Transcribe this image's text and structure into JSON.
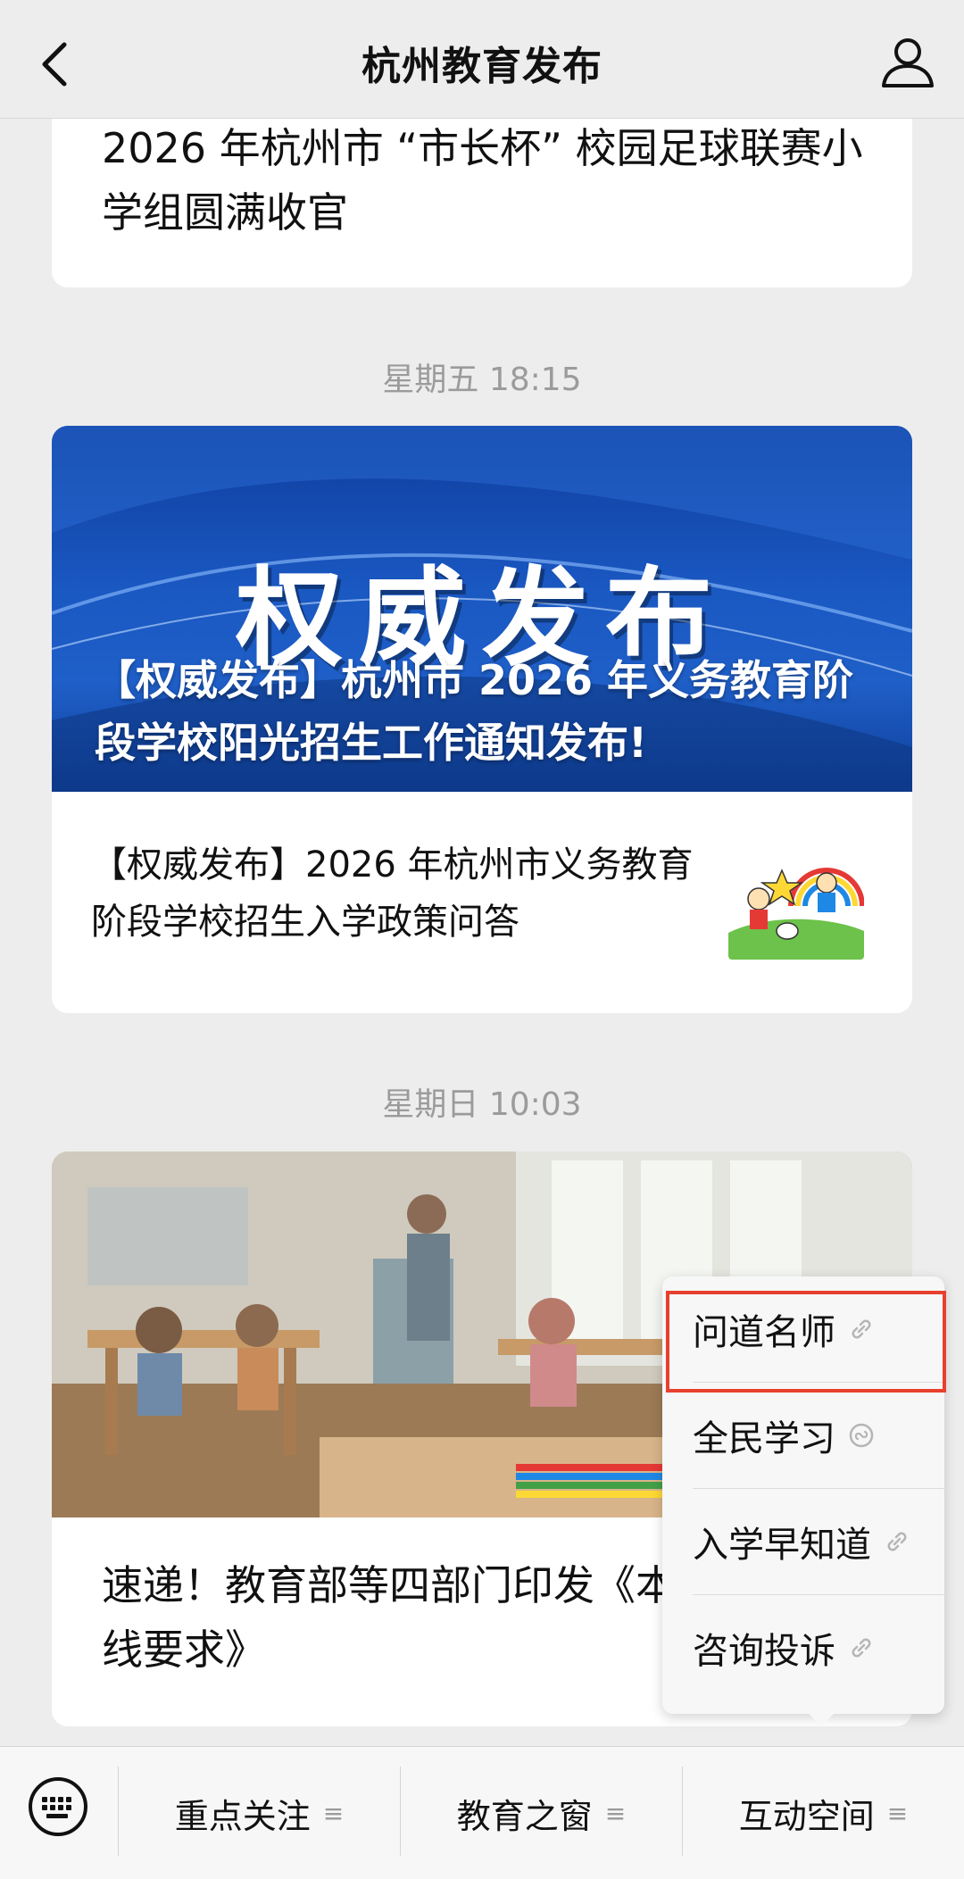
{
  "nav": {
    "title": "杭州教育发布"
  },
  "feed": {
    "card1": {
      "title": "2026 年杭州市 “市长杯” 校园足球联赛小学组圆满收官"
    },
    "time1": "星期五 18:15",
    "card2": {
      "banner_title": "权威发布",
      "banner_caption": "【权威发布】杭州市 2026 年义务教育阶段学校阳光招生工作通知发布!",
      "sub_title": "【权威发布】2026 年杭州市义务教育阶段学校招生入学政策问答"
    },
    "time2": "星期日 10:03",
    "card3": {
      "title": "速递！教育部等四部门印发《本办学条件底线要求》"
    }
  },
  "popup_menu": {
    "items": [
      {
        "label": "问道名师",
        "icon": "link-icon"
      },
      {
        "label": "全民学习",
        "icon": "mini-program-icon"
      },
      {
        "label": "入学早知道",
        "icon": "link-icon"
      },
      {
        "label": "咨询投诉",
        "icon": "link-icon"
      }
    ],
    "highlighted_index": 0,
    "highlight_color": "#e8402e"
  },
  "bottom_bar": {
    "tabs": [
      {
        "label": "重点关注"
      },
      {
        "label": "教育之窗"
      },
      {
        "label": "互动空间"
      }
    ],
    "menu_glyph": "≡"
  },
  "colors": {
    "background": "#ededed",
    "banner_blue": "#1a58c2",
    "time_text": "#9b9b9b"
  }
}
